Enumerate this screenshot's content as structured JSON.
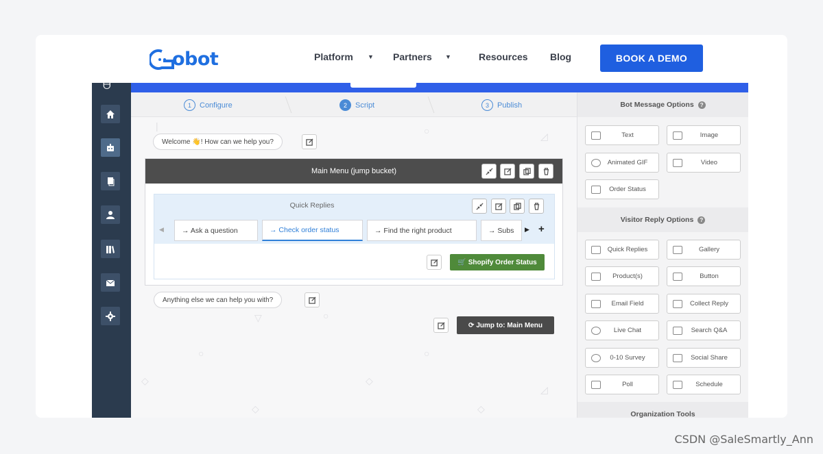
{
  "header": {
    "logo_text": "obot",
    "nav": [
      {
        "label": "Platform",
        "caret": "▼"
      },
      {
        "label": "Partners",
        "caret": "▼"
      },
      {
        "label": "Resources"
      },
      {
        "label": "Blog"
      }
    ],
    "cta_label": "BOOK A DEMO"
  },
  "sidebar": {
    "items": [
      "home-icon",
      "robot-icon",
      "copy-icon",
      "user-icon",
      "library-icon",
      "mail-icon",
      "gear-icon"
    ],
    "active": "robot-icon"
  },
  "steps": [
    {
      "num": "1",
      "label": "Configure"
    },
    {
      "num": "2",
      "label": "Script"
    },
    {
      "num": "3",
      "label": "Publish"
    }
  ],
  "canvas": {
    "welcome_text": "Welcome 👋! How can we help you?",
    "main_menu_title": "Main Menu (jump bucket)",
    "quick_replies_title": "Quick Replies",
    "tabs": [
      "→ Ask a question",
      "→ Check order status",
      "→ Find the right product",
      "→ Subs"
    ],
    "shopify_button": "Shopify Order Status",
    "followup_text": "Anything else we can help you with?",
    "jump_button": "Jump to: Main Menu"
  },
  "panel": {
    "bot_heading": "Bot Message Options",
    "bot_options": [
      "Text",
      "Image",
      "Animated GIF",
      "Video",
      "Order Status"
    ],
    "visitor_heading": "Visitor Reply Options",
    "visitor_options": [
      "Quick Replies",
      "Gallery",
      "Product(s)",
      "Button",
      "Email Field",
      "Collect Reply",
      "Live Chat",
      "Search Q&A",
      "0-10 Survey",
      "Social Share",
      "Poll",
      "Schedule"
    ],
    "org_heading": "Organization Tools",
    "help_glyph": "?"
  },
  "watermark": "CSDN @SaleSmartly_Ann",
  "colors": {
    "brand_blue": "#1f5fe0",
    "sidebar": "#2b3b4e",
    "green": "#4f8a3a"
  }
}
